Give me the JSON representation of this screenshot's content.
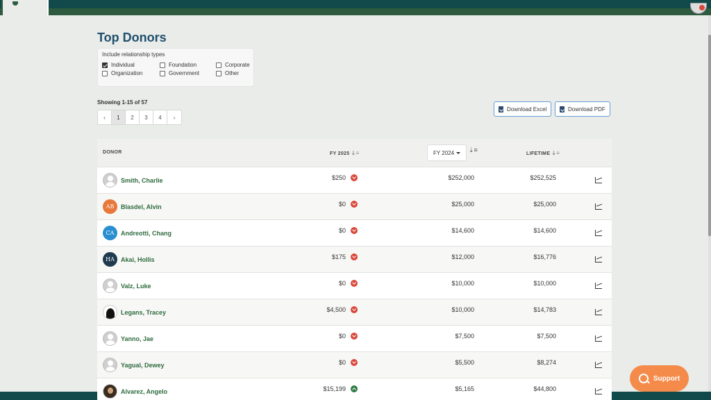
{
  "page": {
    "title": "Top Donors",
    "showing": "Showing 1-15 of 57"
  },
  "filter": {
    "title": "Include relationship types",
    "options": [
      {
        "label": "Individual",
        "checked": true
      },
      {
        "label": "Foundation",
        "checked": false
      },
      {
        "label": "Corporate",
        "checked": false
      },
      {
        "label": "Organization",
        "checked": false
      },
      {
        "label": "Government",
        "checked": false
      },
      {
        "label": "Other",
        "checked": false
      }
    ]
  },
  "pager": {
    "prev": "‹",
    "pages": [
      "1",
      "2",
      "3",
      "4"
    ],
    "next": "›",
    "active": "1"
  },
  "downloads": {
    "excel": "Download Excel",
    "pdf": "Download PDF"
  },
  "table": {
    "headers": {
      "donor": "DONOR",
      "fy2025": "FY 2025",
      "fy_select": "FY 2024",
      "lifetime": "LIFETIME"
    },
    "rows": [
      {
        "name": "Smith, Charlie",
        "avatar": "generic",
        "initials": "",
        "fy2025": "$250",
        "trend": "down",
        "fy2024": "$252,000",
        "lifetime": "$252,525"
      },
      {
        "name": "Blasdel, Alvin",
        "avatar": "initials",
        "initials": "AB",
        "color": "#e8773a",
        "fy2025": "$0",
        "trend": "down",
        "fy2024": "$25,000",
        "lifetime": "$25,000"
      },
      {
        "name": "Andreotti, Chang",
        "avatar": "initials",
        "initials": "CA",
        "color": "#2a8fd0",
        "fy2025": "$0",
        "trend": "down",
        "fy2024": "$14,600",
        "lifetime": "$14,600"
      },
      {
        "name": "Akai, Hollis",
        "avatar": "initials",
        "initials": "HA",
        "color": "#1f3a4f",
        "fy2025": "$175",
        "trend": "down",
        "fy2024": "$12,000",
        "lifetime": "$16,776"
      },
      {
        "name": "Valz, Luke",
        "avatar": "generic",
        "initials": "",
        "fy2025": "$0",
        "trend": "down",
        "fy2024": "$10,000",
        "lifetime": "$10,000"
      },
      {
        "name": "Legans, Tracey",
        "avatar": "silhouette",
        "initials": "",
        "fy2025": "$4,500",
        "trend": "down",
        "fy2024": "$10,000",
        "lifetime": "$14,783"
      },
      {
        "name": "Yanno, Jae",
        "avatar": "generic",
        "initials": "",
        "fy2025": "$0",
        "trend": "down",
        "fy2024": "$7,500",
        "lifetime": "$7,500"
      },
      {
        "name": "Yagual, Dewey",
        "avatar": "generic",
        "initials": "",
        "fy2025": "$0",
        "trend": "down",
        "fy2024": "$5,500",
        "lifetime": "$8,274"
      },
      {
        "name": "Alvarez, Angelo",
        "avatar": "photo",
        "initials": "",
        "fy2025": "$15,199",
        "trend": "up",
        "fy2024": "$5,165",
        "lifetime": "$44,800"
      }
    ]
  },
  "support": {
    "label": "Support"
  },
  "colors": {
    "header_bar": "#2e5a3f",
    "top_strip": "#124a4c",
    "title": "#1f4f6e",
    "donor_link": "#2e6b3e",
    "trend_down": "#d9483b",
    "trend_up": "#2e7a45",
    "support": "#f58b4b"
  }
}
